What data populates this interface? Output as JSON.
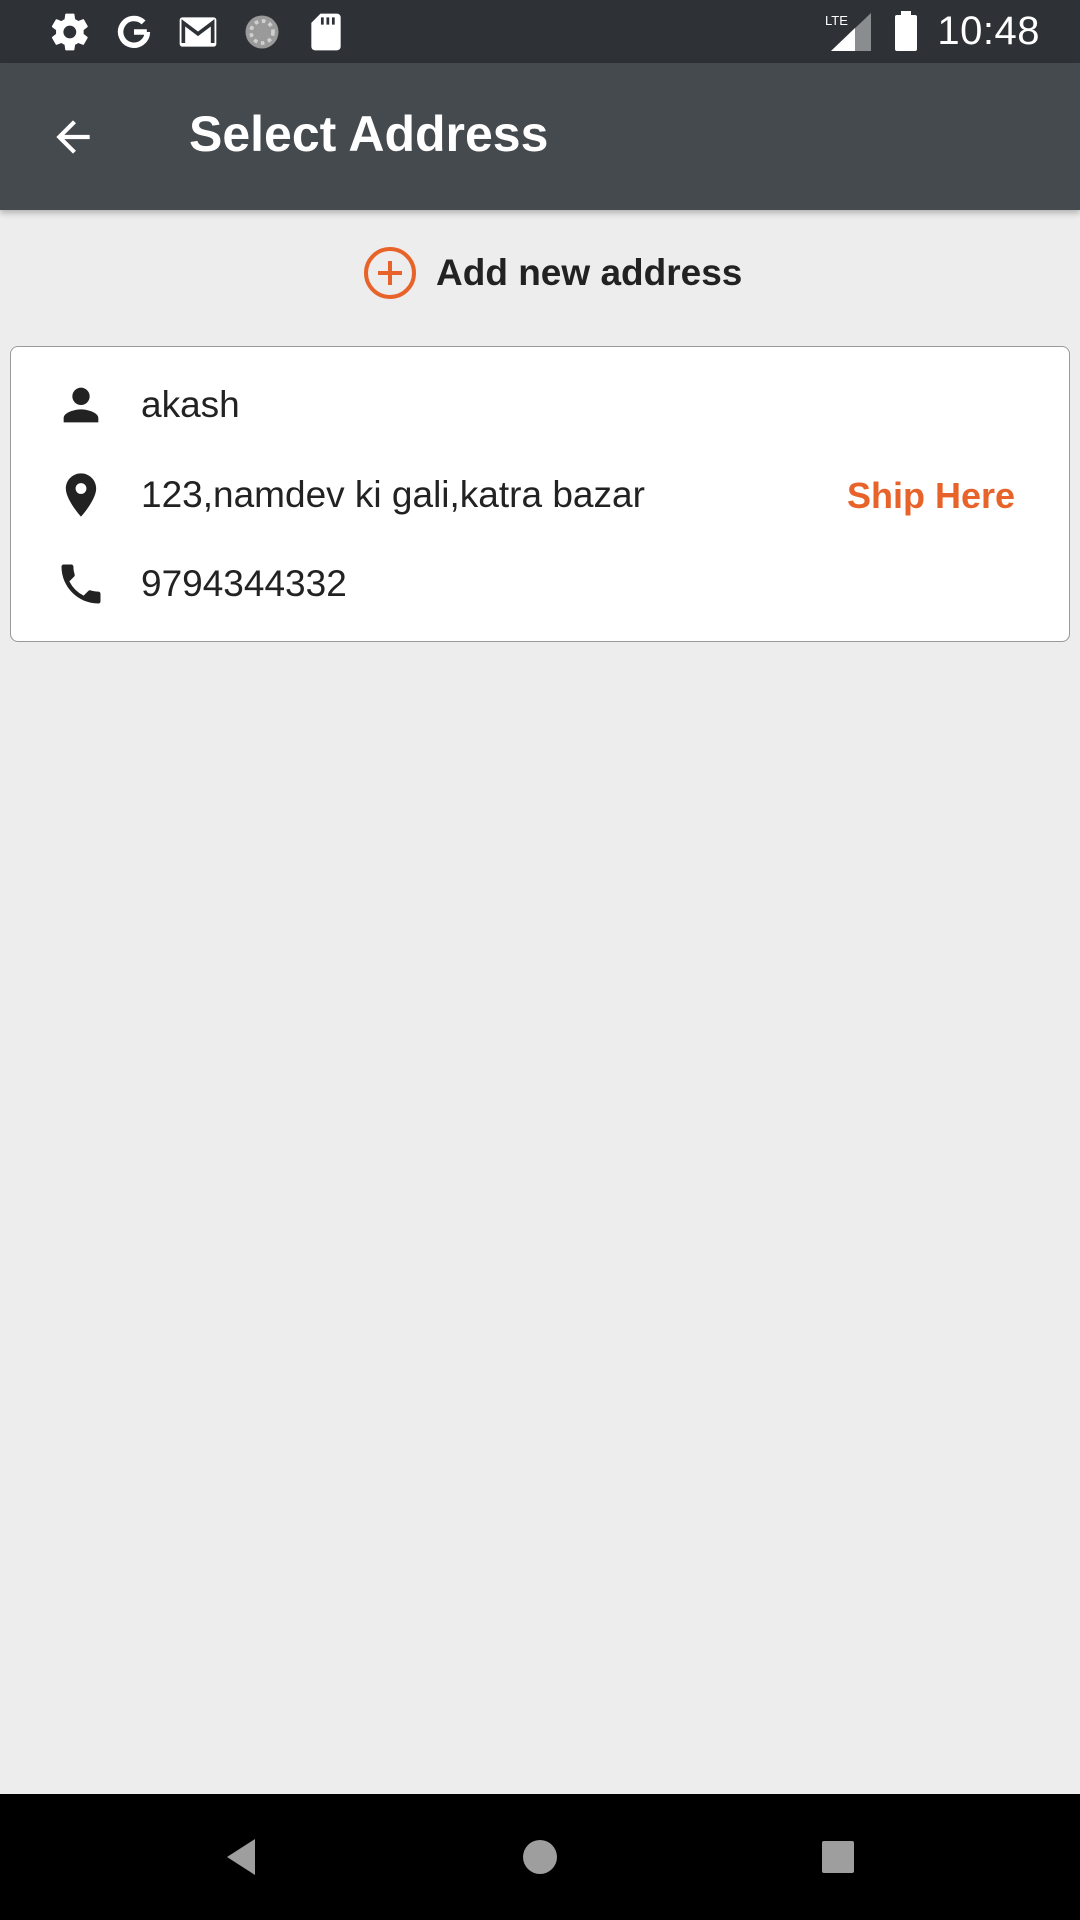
{
  "status_bar": {
    "time": "10:48",
    "network_label": "LTE",
    "left_icons": [
      "gear-icon",
      "google-icon",
      "gmail-icon",
      "sync-icon",
      "sd-card-icon"
    ],
    "right_icons": [
      "lte-signal-icon",
      "battery-icon"
    ]
  },
  "app_bar": {
    "title": "Select Address",
    "back_icon": "arrow-back-icon"
  },
  "add_address": {
    "label": "Add new address",
    "icon": "add-circle-icon"
  },
  "address": {
    "name": "akash",
    "street": "123,namdev ki gali,katra bazar",
    "phone": "9794344332",
    "action_label": "Ship Here"
  },
  "nav_bar": {
    "icons": [
      "nav-back-icon",
      "nav-home-icon",
      "nav-recents-icon"
    ]
  },
  "colors": {
    "accent": "#e8632a",
    "app_bar": "#454a4e",
    "status_bar": "#2e3236",
    "background": "#ededed"
  }
}
